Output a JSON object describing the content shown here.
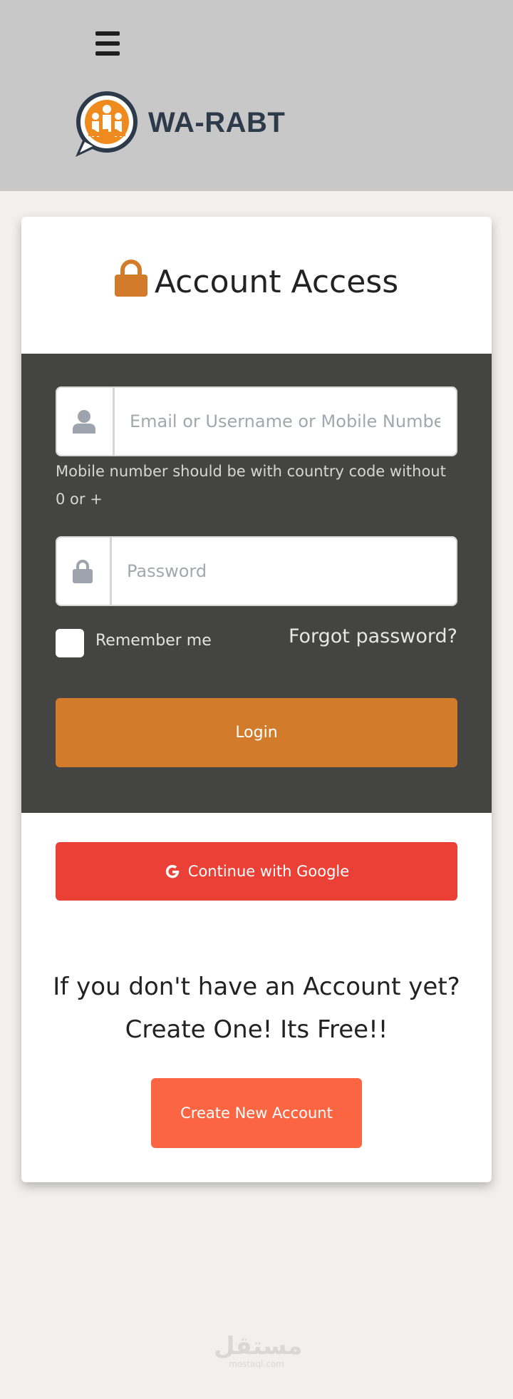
{
  "header": {
    "brand_name": "WA-RABT",
    "background_color": "#c8c8c8"
  },
  "login_card": {
    "title": "Account Access",
    "identifier_input": {
      "placeholder": "Email or Username or Mobile Number",
      "hint": "Mobile number should be with country code without 0 or +"
    },
    "password_input": {
      "placeholder": "Password"
    },
    "remember_me_label": "Remember me",
    "forgot_password_link": "Forgot password?",
    "login_button": "Login",
    "google_button": "Continue with Google"
  },
  "signup": {
    "prompt_line1": "If you don't have an Account yet?",
    "prompt_line2": "Create One! Its Free!!",
    "create_button": "Create New Account"
  },
  "watermark": {
    "arabic": "مستقل",
    "latin": "mostaql.com"
  },
  "colors": {
    "accent_orange": "#d17b2b",
    "panel_dark": "#444442",
    "google_red": "#eb4035",
    "create_orange": "#fb6542",
    "brand_text": "#2d3a4a"
  }
}
